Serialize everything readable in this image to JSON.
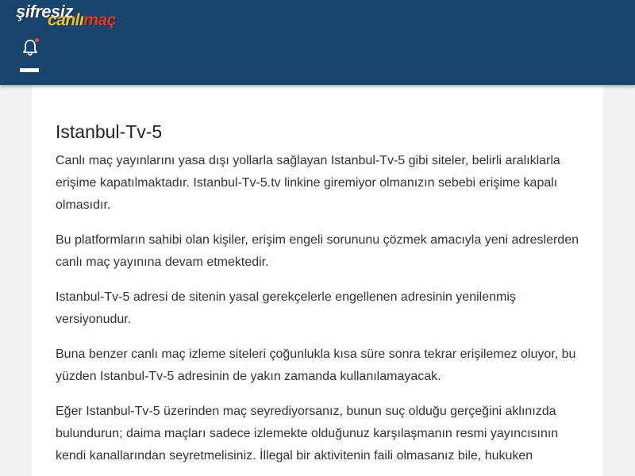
{
  "header": {
    "logo": {
      "part1": "şifresiz",
      "part2a": "canlı",
      "part2b": "maç"
    },
    "bell_icon": "bell-icon",
    "menu_icon": "hamburger-icon"
  },
  "colors": {
    "header_bg": "#17456e",
    "logo_yellow": "#f6c21c",
    "logo_red": "#e8391f",
    "notification_dot": "#e74c3c"
  },
  "article": {
    "title": "Istanbul-Tv-5",
    "paragraphs": [
      "Canlı maç yayınlarını yasa dışı yollarla sağlayan Istanbul-Tv-5 gibi siteler, belirli aralıklarla erişime kapatılmaktadır. Istanbul-Tv-5.tv linkine giremiyor olmanızın sebebi erişime kapalı olmasıdır.",
      "Bu platformların sahibi olan kişiler, erişim engeli sorununu çözmek amacıyla yeni adreslerden canlı maç yayınına devam etmektedir.",
      "Istanbul-Tv-5 adresi de sitenin yasal gerekçelerle engellenen adresinin yenilenmiş versiyonudur.",
      "Buna benzer canlı maç izleme siteleri çoğunlukla kısa süre sonra tekrar erişilemez oluyor, bu yüzden Istanbul-Tv-5 adresinin de yakın zamanda kullanılamayacak.",
      "Eğer Istanbul-Tv-5 üzerinden maç seyrediyorsanız, bunun suç olduğu gerçeğini aklınızda bulundurun; daima maçları sadece izlemekte olduğunuz karşılaşmanın resmi yayıncısının kendi kanallarından seyretmelisiniz. İllegal bir aktivitenin faili olmasanız bile, hukuken"
    ]
  }
}
